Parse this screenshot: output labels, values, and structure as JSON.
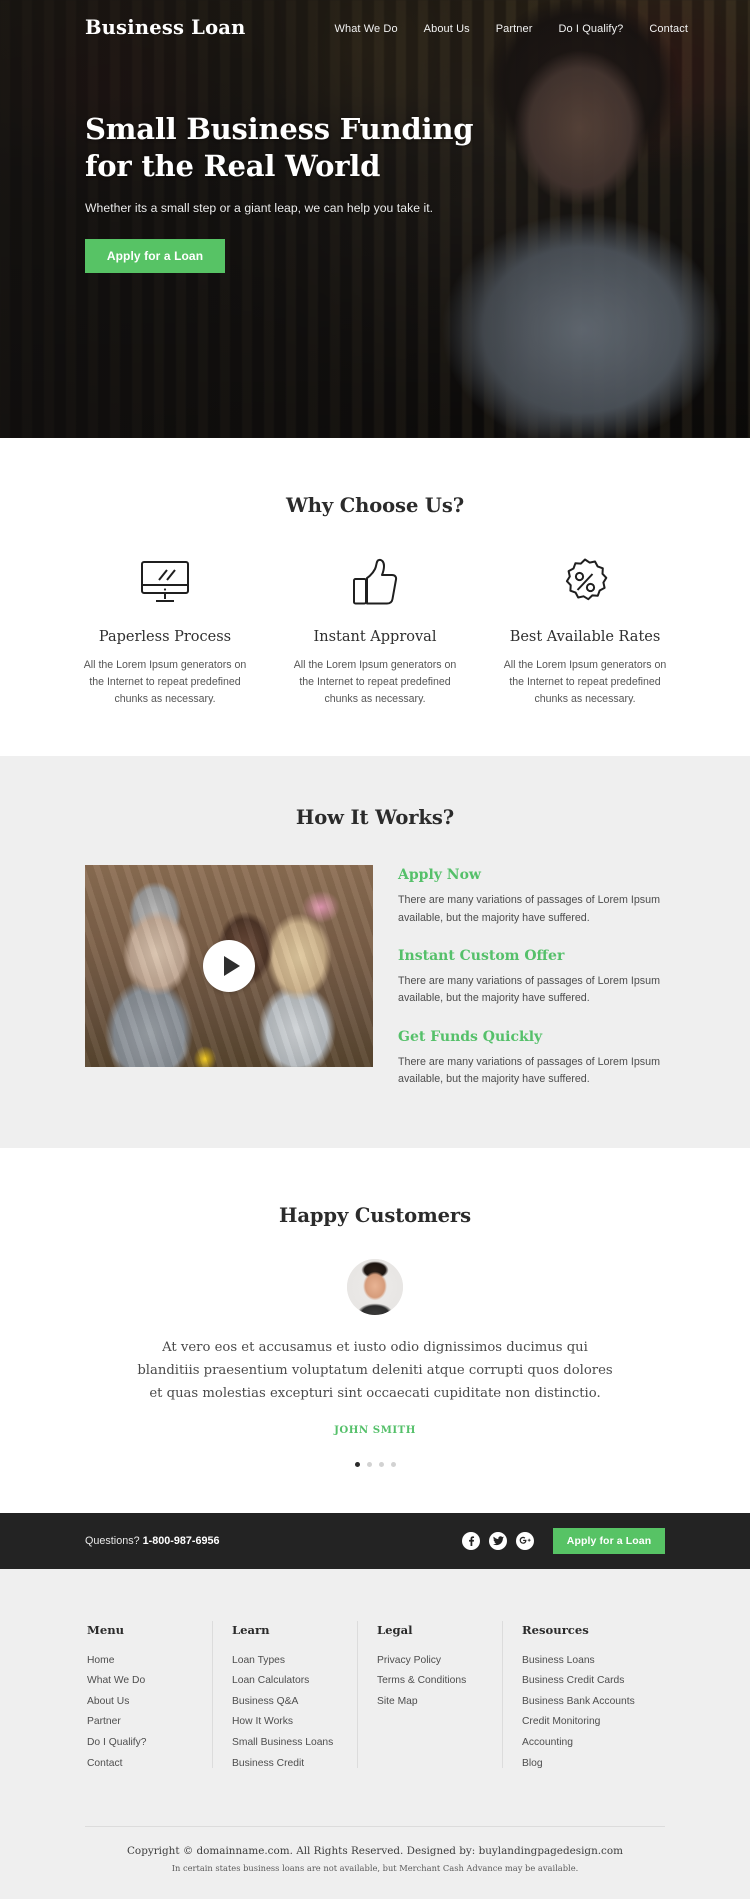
{
  "brand": {
    "logo": "Business Loan",
    "accent_green": "#57c365",
    "dark": "#232323"
  },
  "nav": {
    "items": [
      {
        "label": "What We Do"
      },
      {
        "label": "About Us"
      },
      {
        "label": "Partner"
      },
      {
        "label": "Do I Qualify?"
      },
      {
        "label": "Contact"
      }
    ]
  },
  "hero": {
    "title_line1": "Small Business Funding",
    "title_line2": "for the Real World",
    "subtitle": "Whether its a small step or a giant leap, we can help you take it.",
    "cta_label": "Apply for a Loan"
  },
  "why": {
    "title": "Why Choose Us?",
    "features": [
      {
        "icon": "monitor-icon",
        "title": "Paperless Process",
        "text": "All the Lorem Ipsum generators on the Internet to repeat predefined chunks as necessary."
      },
      {
        "icon": "thumbs-up-icon",
        "title": "Instant Approval",
        "text": "All the Lorem Ipsum generators on the Internet to repeat predefined chunks as necessary."
      },
      {
        "icon": "percent-badge-icon",
        "title": "Best Available Rates",
        "text": "All the Lorem Ipsum generators on the Internet to repeat predefined chunks as necessary."
      }
    ]
  },
  "how": {
    "title": "How It Works?",
    "video": {
      "play_label": "play-button"
    },
    "steps": [
      {
        "title": "Apply Now",
        "text": "There are many variations of passages of Lorem Ipsum available, but the majority have suffered."
      },
      {
        "title": "Instant Custom Offer",
        "text": "There are many variations of passages of Lorem Ipsum available, but the majority have suffered."
      },
      {
        "title": "Get Funds Quickly",
        "text": "There are many variations of passages of Lorem Ipsum available, but the majority have suffered."
      }
    ]
  },
  "testimonial": {
    "title": "Happy Customers",
    "quote": "At vero eos et accusamus et iusto odio dignissimos ducimus qui blanditiis praesentium voluptatum deleniti atque corrupti quos dolores et quas molestias excepturi sint occaecati cupiditate non distinctio.",
    "author": "JOHN SMITH",
    "dots": 4,
    "active_dot": 0
  },
  "cta_bar": {
    "questions_label": "Questions? ",
    "phone": "1-800-987-6956",
    "social": [
      {
        "name": "facebook-icon",
        "glyph": "f"
      },
      {
        "name": "twitter-icon",
        "glyph": "t"
      },
      {
        "name": "google-plus-icon",
        "glyph": "G+"
      }
    ],
    "cta_label": "Apply for a Loan"
  },
  "footer": {
    "columns": [
      {
        "title": "Menu",
        "links": [
          "Home",
          "What We Do",
          "About Us",
          "Partner",
          "Do I Qualify?",
          "Contact"
        ]
      },
      {
        "title": "Learn",
        "links": [
          "Loan Types",
          "Loan Calculators",
          "Business Q&A",
          "How It Works",
          "Small Business Loans",
          "Business Credit"
        ]
      },
      {
        "title": "Legal",
        "links": [
          "Privacy Policy",
          "Terms & Conditions",
          "Site Map"
        ]
      },
      {
        "title": "Resources",
        "links": [
          "Business Loans",
          "Business Credit Cards",
          "Business Bank Accounts",
          "Credit Monitoring",
          "Accounting",
          "Blog"
        ]
      }
    ],
    "copyright": "Copyright © domainname.com. All Rights Reserved. Designed by: buylandingpagedesign.com",
    "disclaimer": "In certain states business loans are not available, but Merchant Cash Advance may be available."
  }
}
